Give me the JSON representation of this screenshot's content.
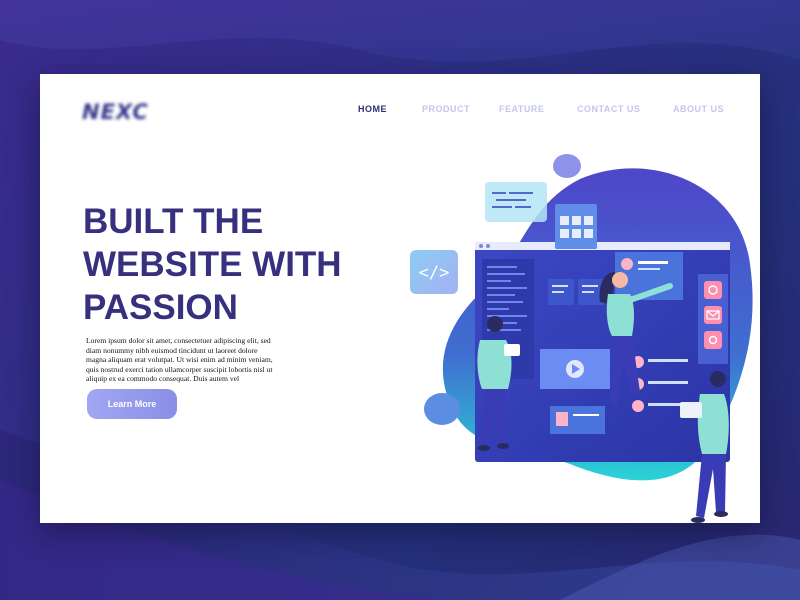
{
  "brand": {
    "logo_text": "NEXC"
  },
  "nav": {
    "items": [
      {
        "label": "HOME",
        "active": true
      },
      {
        "label": "PRODUCT",
        "active": false
      },
      {
        "label": "FEATURE",
        "active": false
      },
      {
        "label": "CONTACT US",
        "active": false
      },
      {
        "label": "ABOUT US",
        "active": false
      }
    ]
  },
  "hero": {
    "headline_lines": [
      "BUILT THE",
      "WEBSITE WITH",
      "PASSION"
    ],
    "body_lines": [
      "Lorem ipsum dolor sit amet, consectetuer adipiscing elit, sed",
      "diam nonummy nibh euismod tincidunt ut laoreet dolore",
      "magna aliquam erat volutpat. Ut wisi enim ad minim veniam,",
      "quis nostrud exerci tation ullamcorper suscipit lobortis nisl ut",
      "aliquip ex ea commodo consequat. Duis autem vel"
    ],
    "cta_label": "Learn More"
  },
  "illustration": {
    "code_badge": "</>",
    "icons": [
      "code-icon",
      "home-icon",
      "mail-icon",
      "camera-icon",
      "play-icon",
      "user-icon"
    ]
  },
  "colors": {
    "background": "#2d2f86",
    "accent": "#37307e",
    "button": "#8a8fe6",
    "nav_inactive": "#c3c6ec",
    "nav_active": "#2f2d7a"
  }
}
